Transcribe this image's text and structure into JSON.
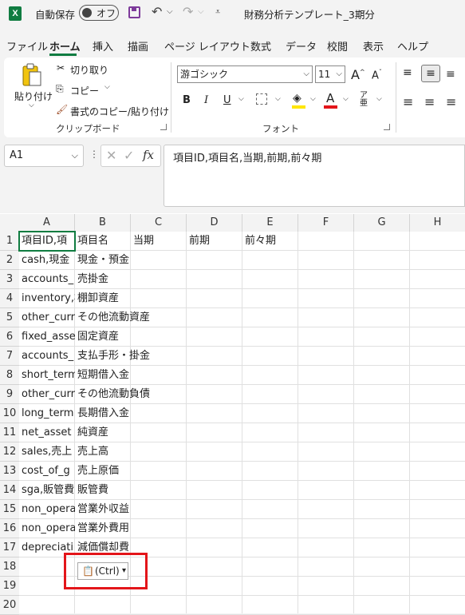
{
  "titlebar": {
    "app_logo": "X",
    "autosave_label": "自動保存",
    "autosave_state": "オフ",
    "file_title": "財務分析テンプレート_3期分",
    "title_chevron": "⌵",
    "icons": [
      "excel-logo-icon",
      "save-icon",
      "undo-icon",
      "redo-icon",
      "customize-qat-icon"
    ]
  },
  "ribbon_tabs": [
    "ファイル",
    "ホーム",
    "挿入",
    "描画",
    "ページ レイアウト",
    "数式",
    "データ",
    "校閲",
    "表示",
    "ヘルプ"
  ],
  "ribbon": {
    "clipboard": {
      "paste_label": "貼り付け",
      "cut_label": "切り取り",
      "copy_label": "コピー",
      "format_painter_label": "書式のコピー/貼り付け",
      "group_label": "クリップボード"
    },
    "font": {
      "font_name": "游ゴシック",
      "font_size": "11",
      "bold": "B",
      "italic": "I",
      "underline": "U",
      "grow": "A",
      "shrink": "A",
      "group_label": "フォント",
      "font_color": "#e3151a",
      "highlight_color": "#ffe600"
    }
  },
  "formula_bar": {
    "name_box": "A1",
    "fx": "fx",
    "content": "項目ID,項目名,当期,前期,前々期"
  },
  "grid": {
    "columns": [
      "A",
      "B",
      "C",
      "D",
      "E",
      "F",
      "G",
      "H"
    ],
    "rows": [
      "1",
      "2",
      "3",
      "4",
      "5",
      "6",
      "7",
      "8",
      "9",
      "10",
      "11",
      "12",
      "13",
      "14",
      "15",
      "16",
      "17",
      "18",
      "19",
      "20"
    ],
    "colA": [
      "項目ID,項",
      "cash,現金",
      "accounts_",
      "inventory,棚",
      "other_curr",
      "fixed_asse",
      "accounts_",
      "short_term",
      "other_curr",
      "long_term",
      "net_asset",
      "sales,売上",
      "cost_of_g",
      "sga,販管費",
      "non_opera",
      "non_opera",
      "depreciati"
    ],
    "colB": [
      "項目名",
      "現金・預金",
      "売掛金",
      "棚卸資産",
      "その他流動資産",
      "固定資産",
      "支払手形・掛金",
      "短期借入金",
      "その他流動負債",
      "長期借入金",
      "純資産",
      "売上高",
      "売上原価",
      "販管費",
      "営業外収益",
      "営業外費用",
      "減価償却費"
    ],
    "row1_extra": {
      "C": "当期",
      "D": "前期",
      "E": "前々期"
    }
  },
  "paste_options": {
    "label": "(Ctrl)",
    "arrow": "▾"
  },
  "colors": {
    "accent": "#107c41",
    "highlight_box": "#e3151a"
  }
}
